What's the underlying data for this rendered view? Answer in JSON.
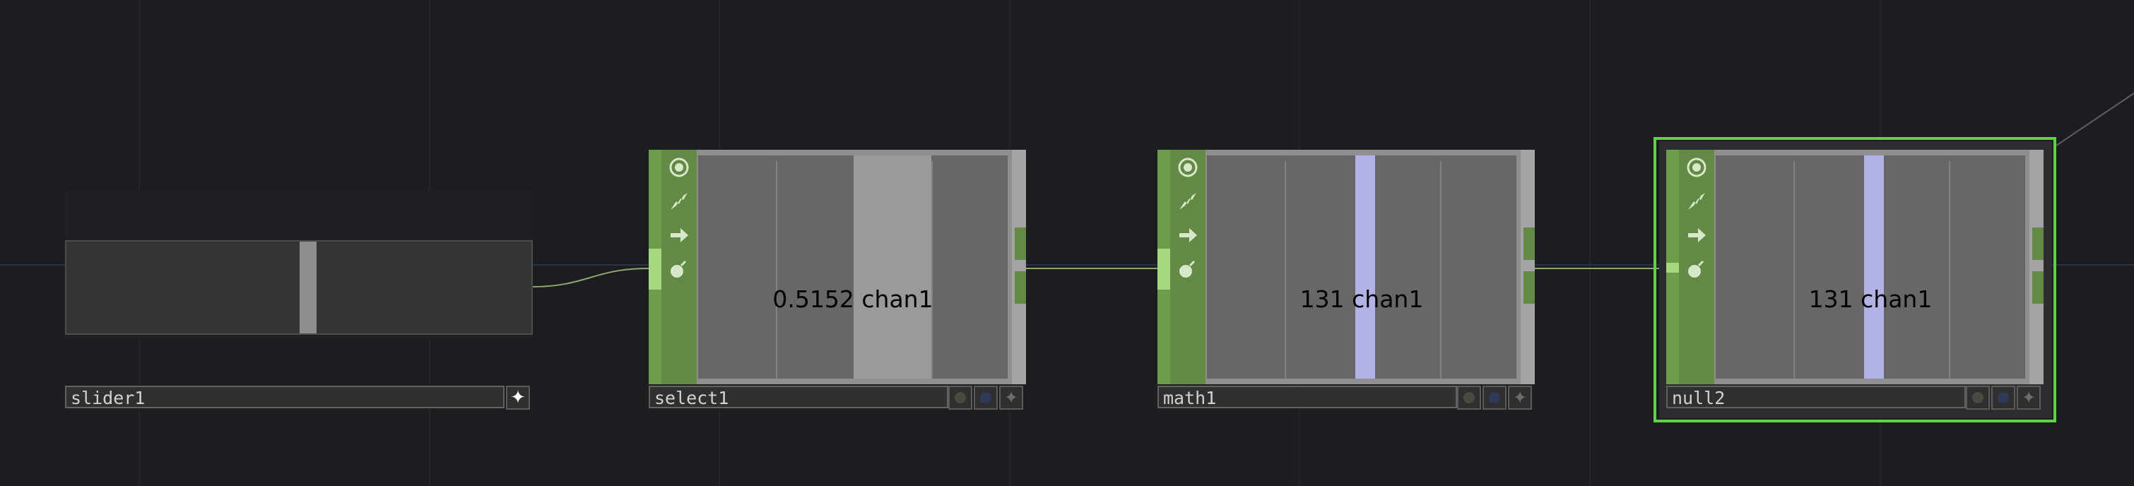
{
  "nodes": {
    "slider": {
      "name": "slider1",
      "value": 0.52
    },
    "select": {
      "name": "select1",
      "value_label": "0.5152 chan1"
    },
    "math": {
      "name": "math1",
      "value_label": "131 chan1"
    },
    "null": {
      "name": "null2",
      "value_label": "131 chan1",
      "selected": true
    }
  },
  "colors": {
    "background": "#1c1d21",
    "node_green": "#628a45",
    "selection_green": "#5fd343",
    "channel_bar_select": "#9a9a9a",
    "channel_bar_math": "#b2b2e6",
    "wire": "#8ca870"
  },
  "icons": [
    "viewer-toggle-icon",
    "cook-icon",
    "export-arrow-icon",
    "bypass-icon",
    "plus-icon"
  ]
}
